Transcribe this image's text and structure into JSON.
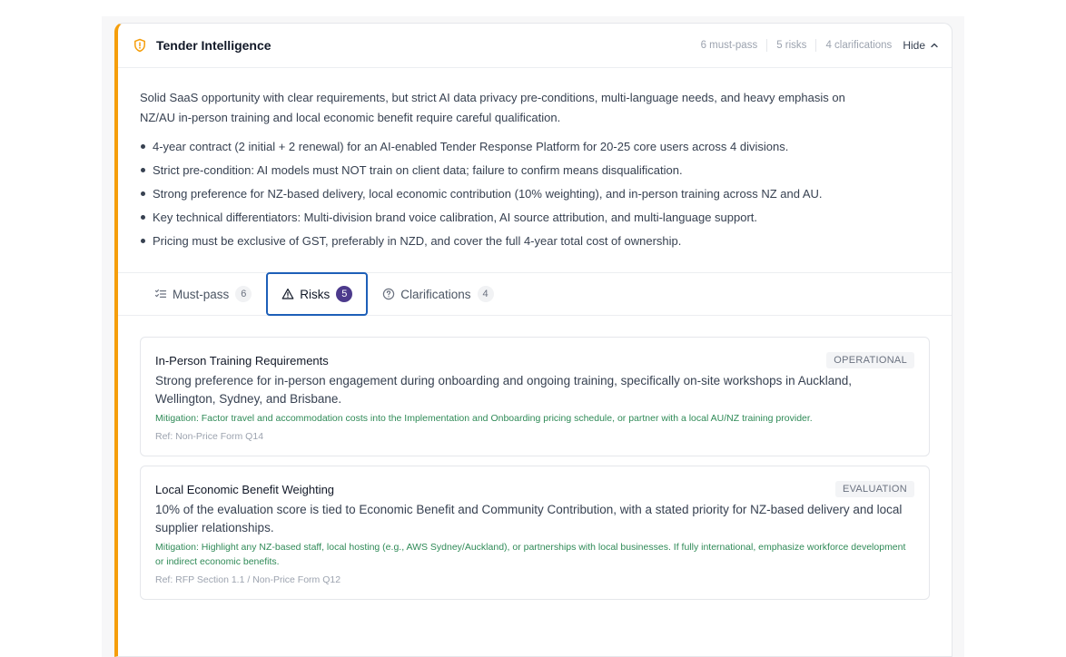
{
  "panel": {
    "title": "Tender Intelligence",
    "stats": {
      "must_pass": "6 must-pass",
      "risks": "5 risks",
      "clarifications": "4 clarifications"
    },
    "hide_label": "Hide",
    "accent_color": "#f59e0b"
  },
  "summary": {
    "text": "Solid SaaS opportunity with clear requirements, but strict AI data privacy pre-conditions, multi-language needs, and heavy emphasis on NZ/AU in-person training and local economic benefit require careful qualification.",
    "bullets": [
      "4-year contract (2 initial + 2 renewal) for an AI-enabled Tender Response Platform for 20-25 core users across 4 divisions.",
      "Strict pre-condition: AI models must NOT train on client data; failure to confirm means disqualification.",
      "Strong preference for NZ-based delivery, local economic contribution (10% weighting), and in-person training across NZ and AU.",
      "Key technical differentiators: Multi-division brand voice calibration, AI source attribution, and multi-language support.",
      "Pricing must be exclusive of GST, preferably in NZD, and cover the full 4-year total cost of ownership."
    ]
  },
  "tabs": [
    {
      "label": "Must-pass",
      "count": "6",
      "icon": "checklist-icon",
      "active": false
    },
    {
      "label": "Risks",
      "count": "5",
      "icon": "warning-icon",
      "active": true
    },
    {
      "label": "Clarifications",
      "count": "4",
      "icon": "question-icon",
      "active": false
    }
  ],
  "risks": [
    {
      "title": "In-Person Training Requirements",
      "tag": "OPERATIONAL",
      "description": "Strong preference for in-person engagement during onboarding and ongoing training, specifically on-site workshops in Auckland, Wellington, Sydney, and Brisbane.",
      "mitigation": "Mitigation: Factor travel and accommodation costs into the Implementation and Onboarding pricing schedule, or partner with a local AU/NZ training provider.",
      "ref": "Ref: Non-Price Form Q14"
    },
    {
      "title": "Local Economic Benefit Weighting",
      "tag": "EVALUATION",
      "description": "10% of the evaluation score is tied to Economic Benefit and Community Contribution, with a stated priority for NZ-based delivery and local supplier relationships.",
      "mitigation": "Mitigation: Highlight any NZ-based staff, local hosting (e.g., AWS Sydney/Auckland), or partnerships with local businesses. If fully international, emphasize workforce development or indirect economic benefits.",
      "ref": "Ref: RFP Section 1.1 / Non-Price Form Q12"
    }
  ]
}
